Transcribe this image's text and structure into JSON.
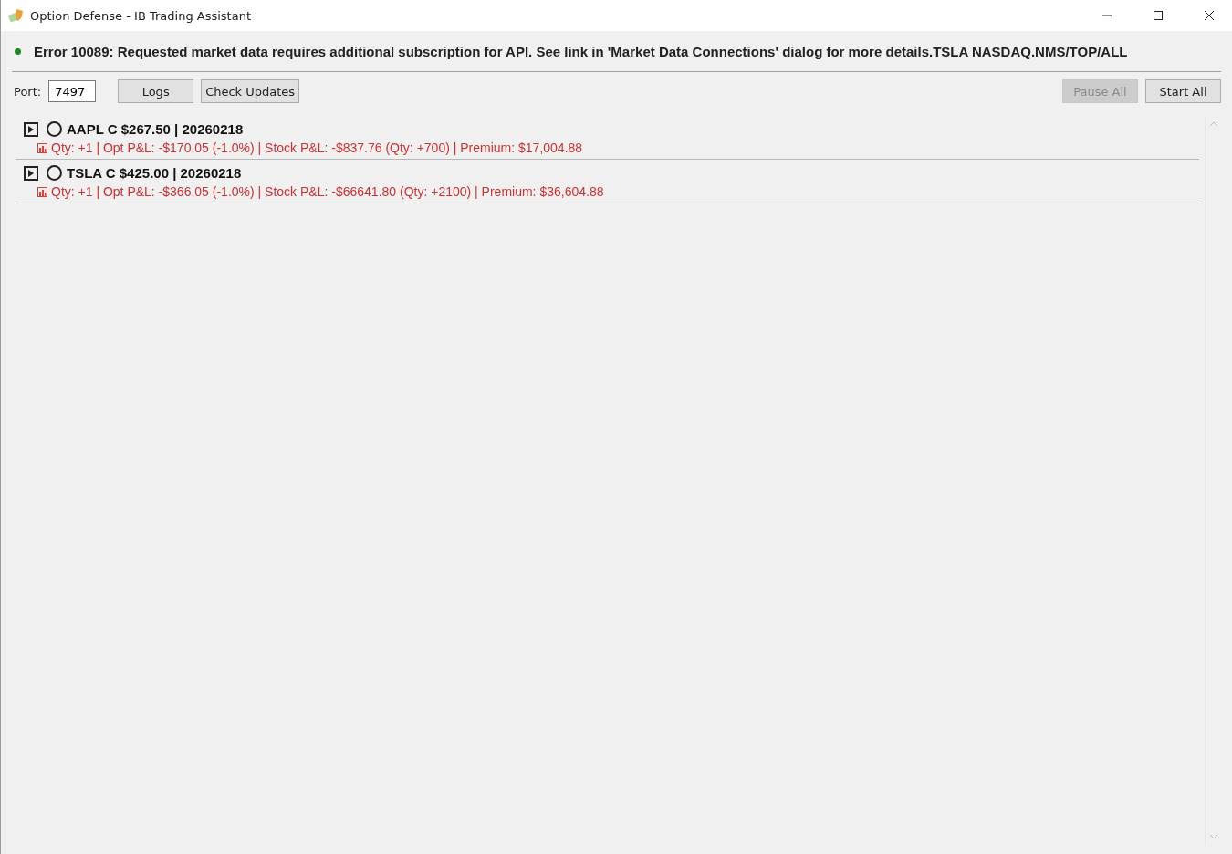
{
  "window": {
    "title": "Option Defense - IB Trading Assistant"
  },
  "status": {
    "color": "#1e8a1e",
    "message": "Error 10089: Requested market data requires additional subscription for API. See link in 'Market Data Connections' dialog for more details.TSLA NASDAQ.NMS/TOP/ALL"
  },
  "toolbar": {
    "port_label": "Port:",
    "port_value": "7497",
    "buttons": [
      {
        "label": "Logs",
        "disabled": false
      },
      {
        "label": "Check Updates",
        "disabled": false
      }
    ],
    "right_buttons": [
      {
        "label": "Pause All",
        "disabled": true
      },
      {
        "label": "Start All",
        "disabled": false
      }
    ]
  },
  "positions": [
    {
      "title": "AAPL C $267.50 | 20260218",
      "expanded": false,
      "selected": false,
      "details": "Qty: +1 | Opt P&L: -$170.05 (-1.0%) | Stock P&L: -$837.76 (Qty: +700) | Premium: $17,004.88"
    },
    {
      "title": "TSLA C $425.00 | 20260218",
      "expanded": false,
      "selected": false,
      "details": "Qty: +1 | Opt P&L: -$366.05 (-1.0%) | Stock P&L: -$66641.80 (Qty: +2100) | Premium: $36,604.88"
    }
  ]
}
